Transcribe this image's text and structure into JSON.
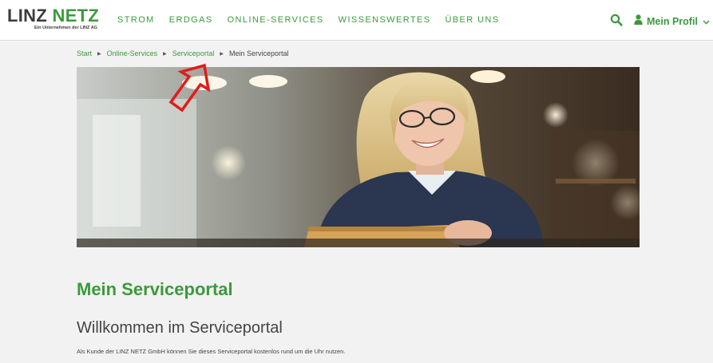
{
  "brand": {
    "name_part1": "LINZ",
    "name_part2": "NETZ",
    "tagline": "Ein Unternehmen der LINZ AG",
    "accent_color": "#3b9a3b"
  },
  "nav": {
    "items": [
      {
        "label": "STROM"
      },
      {
        "label": "ERDGAS"
      },
      {
        "label": "ONLINE-SERVICES"
      },
      {
        "label": "WISSENSWERTES"
      },
      {
        "label": "ÜBER UNS"
      }
    ],
    "search_icon": "search-icon",
    "profile_label": "Mein Profil",
    "profile_icon": "user-icon",
    "profile_chevron": "chevron-down-icon"
  },
  "breadcrumb": {
    "items": [
      "Start",
      "Online-Services",
      "Serviceportal"
    ],
    "current": "Mein Serviceportal"
  },
  "hero": {
    "image": "photo-woman-smiling-using-tablet-in-cafe",
    "annotation": "red-outline-arrow-pointing-to-serviceportal-breadcrumb"
  },
  "main": {
    "title": "Mein Serviceportal",
    "welcome": "Willkommen im Serviceportal",
    "intro": "Als Kunde der LINZ NETZ GmbH können Sie dieses Serviceportal kostenlos rund um die Uhr nutzen."
  }
}
